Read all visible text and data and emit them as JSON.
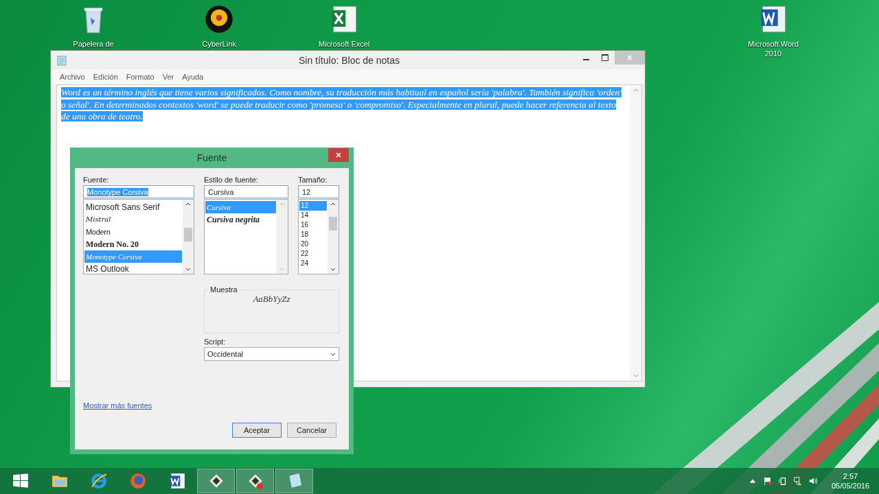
{
  "desktop_icons": [
    {
      "label": "Papelera de",
      "kind": "bin"
    },
    {
      "label": "CyberLink",
      "kind": "cam"
    },
    {
      "label": "Microsoft Excel",
      "kind": "excel"
    },
    {
      "label": "Microsoft Word\n2010",
      "kind": "word"
    }
  ],
  "notepad": {
    "title": "Sin título: Bloc de notas",
    "menu": [
      "Archivo",
      "Edición",
      "Formato",
      "Ver",
      "Ayuda"
    ],
    "text": "Word es un término inglés que tiene varios significados. Como nombre, su traducción más habitual en español sería 'palabra'. También significa 'orden' o señal'. En determinados contextos 'word' se puede traducir como 'promesa' o 'compromiso'. Especialmente en plural, puede hacer referencia al texto de una obra de teatro."
  },
  "font_dialog": {
    "title": "Fuente",
    "font": {
      "label": "Fuente:",
      "value": "Monotype Corsiva",
      "items": [
        {
          "label": "Microsoft Sans Serif",
          "kind": "sans",
          "selected": false
        },
        {
          "label": "Mistral",
          "kind": "script",
          "selected": false
        },
        {
          "label": "Modern",
          "kind": "plain",
          "selected": false
        },
        {
          "label": "Modern No. 20",
          "kind": "bold",
          "selected": false
        },
        {
          "label": "Monotype Corsiva",
          "kind": "italic",
          "selected": true
        },
        {
          "label": "MS Outlook",
          "kind": "sans",
          "selected": false
        }
      ]
    },
    "style": {
      "label": "Estilo de fuente:",
      "value": "Cursiva",
      "items": [
        {
          "label": "Cursiva",
          "kind": "italic",
          "selected": true
        },
        {
          "label": "Cursiva negrita",
          "kind": "bolditalic",
          "selected": false
        }
      ]
    },
    "size": {
      "label": "Tamaño:",
      "value": "12",
      "items": [
        {
          "label": "12",
          "selected": true
        },
        {
          "label": "14",
          "selected": false
        },
        {
          "label": "16",
          "selected": false
        },
        {
          "label": "18",
          "selected": false
        },
        {
          "label": "20",
          "selected": false
        },
        {
          "label": "22",
          "selected": false
        },
        {
          "label": "24",
          "selected": false
        }
      ]
    },
    "sample": {
      "label": "Muestra",
      "text": "AaBbYyZz"
    },
    "script": {
      "label": "Script:",
      "value": "Occidental"
    },
    "link": "Mostrar más fuentes",
    "buttons": [
      {
        "label": "Aceptar",
        "default": true
      },
      {
        "label": "Cancelar",
        "default": false
      }
    ]
  },
  "taskbar": {
    "items": [
      {
        "kind": "start",
        "open": false
      },
      {
        "kind": "folder",
        "open": false
      },
      {
        "kind": "ie",
        "open": false
      },
      {
        "kind": "firefox",
        "open": false
      },
      {
        "kind": "word",
        "open": false
      },
      {
        "kind": "app",
        "open": true
      },
      {
        "kind": "app-rec",
        "open": true
      },
      {
        "kind": "notepad",
        "open": true
      }
    ],
    "time": "2:57",
    "date": "05/05/2016"
  }
}
